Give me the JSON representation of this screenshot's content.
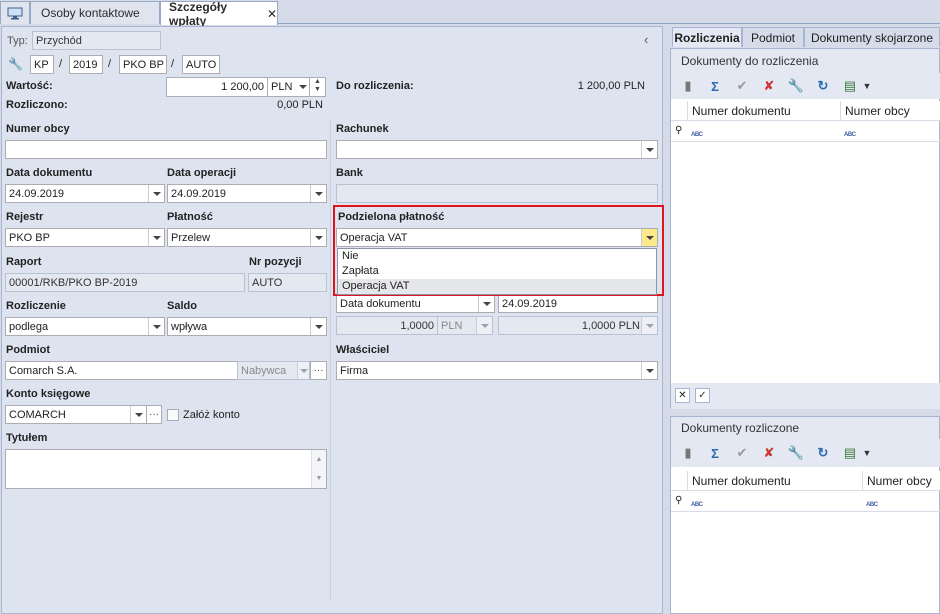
{
  "tabs": {
    "contacts": "Osoby kontaktowe",
    "payment": "Szczegóły wpłaty"
  },
  "form": {
    "typ_label": "Typ:",
    "typ_value": "Przychód",
    "number": {
      "kp": "KP",
      "sep": "/",
      "year": "2019",
      "register": "PKO BP",
      "auto": "AUTO"
    },
    "wartosc_label": "Wartość:",
    "wartosc_value": "1 200,00",
    "currency": "PLN",
    "rozliczono_label": "Rozliczono:",
    "rozliczono_value": "0,00 PLN",
    "do_rozliczenia_label": "Do rozliczenia:",
    "do_rozliczenia_value": "1 200,00 PLN",
    "numer_obcy_label": "Numer obcy",
    "rachunek_label": "Rachunek",
    "data_dokumentu_label": "Data dokumentu",
    "data_dokumentu_value": "24.09.2019",
    "data_operacji_label": "Data operacji",
    "data_operacji_value": "24.09.2019",
    "bank_label": "Bank",
    "rejestr_label": "Rejestr",
    "rejestr_value": "PKO BP",
    "platnosc_label": "Płatność",
    "platnosc_value": "Przelew",
    "podzielona_label": "Podzielona płatność",
    "podzielona_value": "Operacja VAT",
    "podzielona_options": [
      "Nie",
      "Zapłata",
      "Operacja VAT"
    ],
    "raport_label": "Raport",
    "raport_value": "00001/RKB/PKO BP-2019",
    "nr_pozycji_label": "Nr pozycji",
    "nr_pozycji_value": "AUTO",
    "kurs_type": "Data dokumentu",
    "kurs_date": "24.09.2019",
    "kurs_rate": "1,0000",
    "kurs_currency": "PLN",
    "kurs_value": "1,0000 PLN",
    "rozliczenie_label": "Rozliczenie",
    "rozliczenie_value": "podlega",
    "saldo_label": "Saldo",
    "saldo_value": "wpływa",
    "podmiot_label": "Podmiot",
    "podmiot_value": "Comarch S.A.",
    "podmiot_role": "Nabywca",
    "wlasciciel_label": "Właściciel",
    "wlasciciel_value": "Firma",
    "konto_label": "Konto księgowe",
    "konto_value": "COMARCH",
    "zaloz_konto": "Załóż konto",
    "tytulem_label": "Tytułem",
    "more": "···"
  },
  "right": {
    "tabs": [
      "Rozliczenia",
      "Podmiot",
      "Dokumenty skojarzone"
    ],
    "group1_title": "Dokumenty do rozliczenia",
    "group2_title": "Dokumenty rozliczone",
    "col_numer": "Numer dokumentu",
    "col_obcy": "Numer obcy",
    "filter_icon": "ABC"
  },
  "colors": {
    "highlight": "#e0141e",
    "accent": "#2d6bb3"
  }
}
